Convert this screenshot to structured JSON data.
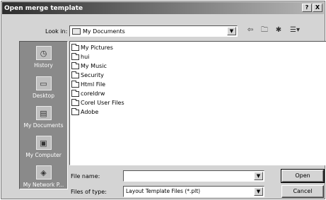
{
  "dialog": {
    "title": "Open merge template",
    "help_glyph": "?",
    "close_glyph": "X"
  },
  "lookin": {
    "label": "Look in:",
    "value": "My Documents",
    "arrow": "▼"
  },
  "toolbar": {
    "back": "⇦",
    "up": "🗀",
    "new_folder": "✱",
    "views": "☰▾"
  },
  "places": [
    {
      "label": "History",
      "icon": "history-icon"
    },
    {
      "label": "Desktop",
      "icon": "desktop-icon"
    },
    {
      "label": "My Documents",
      "icon": "my-documents-icon"
    },
    {
      "label": "My Computer",
      "icon": "my-computer-icon"
    },
    {
      "label": "My Network P...",
      "icon": "network-icon"
    }
  ],
  "files": [
    "My Pictures",
    "hui",
    "My Music",
    "Security",
    "Html File",
    "coreldrw",
    "Corel User Files",
    "Adobe"
  ],
  "filename": {
    "label": "File name:",
    "value": "",
    "placeholder": ""
  },
  "filetype": {
    "label": "Files of type:",
    "value": "Layout Template Files (*.plt)"
  },
  "buttons": {
    "open": "Open",
    "cancel": "Cancel"
  }
}
